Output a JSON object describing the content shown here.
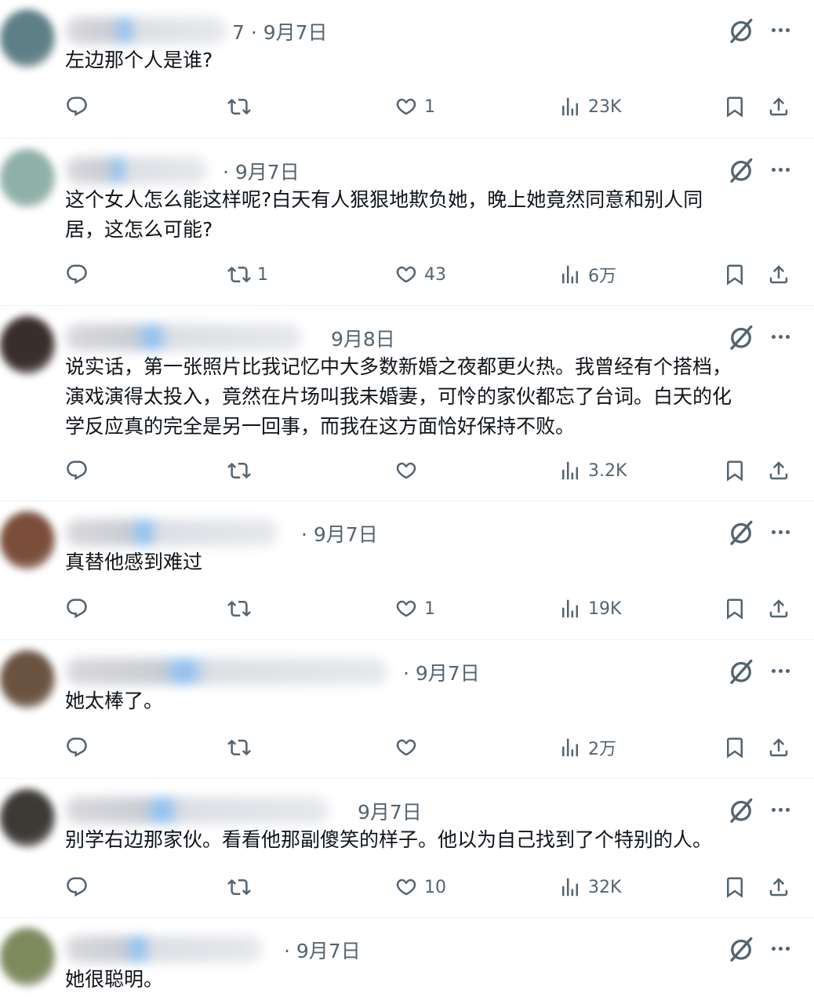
{
  "tweets": [
    {
      "time": "7 · 9月7日",
      "text": "左边那个人是谁?",
      "replies": "",
      "retweets": "",
      "likes": "1",
      "views": "23K",
      "avatar_color": "#5d7f86"
    },
    {
      "time": "· 9月7日",
      "text": "这个女人怎么能这样呢?白天有人狠狠地欺负她，晚上她竟然同意和别人同\n居，这怎么可能?",
      "replies": "",
      "retweets": "1",
      "likes": "43",
      "views": "6万",
      "avatar_color": "#8fb0a8"
    },
    {
      "time": "9月8日",
      "text": "说实话，第一张照片比我记忆中大多数新婚之夜都更火热。我曾经有个搭档，\n演戏演得太投入，竟然在片场叫我未婚妻，可怜的家伙都忘了台词。白天的化\n学反应真的完全是另一回事，而我在这方面恰好保持不败。",
      "replies": "",
      "retweets": "",
      "likes": "",
      "views": "3.2K",
      "avatar_color": "#3a2e2b"
    },
    {
      "time": "· 9月7日",
      "text": "真替他感到难过",
      "replies": "",
      "retweets": "",
      "likes": "1",
      "views": "19K",
      "avatar_color": "#7a4e3a"
    },
    {
      "time": "· 9月7日",
      "text": "她太棒了。",
      "replies": "",
      "retweets": "",
      "likes": "",
      "views": "2万",
      "avatar_color": "#6a5340"
    },
    {
      "time": "9月7日",
      "text": "别学右边那家伙。看看他那副傻笑的样子。他以为自己找到了个特别的人。",
      "replies": "",
      "retweets": "",
      "likes": "10",
      "views": "32K",
      "avatar_color": "#3d3a36"
    },
    {
      "time": "· 9月7日",
      "text": "她很聪明。",
      "replies": "",
      "retweets": "",
      "likes": "",
      "views": "",
      "avatar_color": "#7d8a5c"
    }
  ],
  "colors": {
    "muted": "#536471",
    "text": "#0f1419",
    "divider": "#eff3f4"
  },
  "icons": [
    "reply-icon",
    "retweet-icon",
    "like-icon",
    "views-icon",
    "bookmark-icon",
    "share-icon",
    "grok-icon",
    "more-icon"
  ]
}
